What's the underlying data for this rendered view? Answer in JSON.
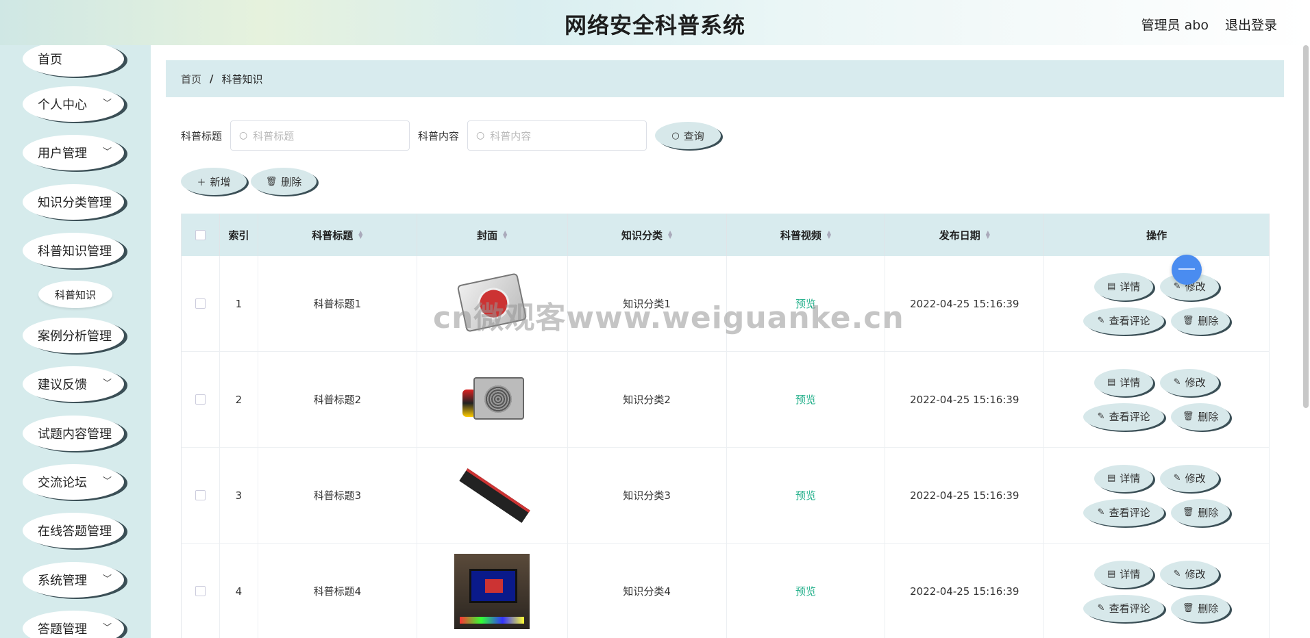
{
  "header": {
    "title": "网络安全科普系统",
    "user": "管理员 abo",
    "logout": "退出登录"
  },
  "sidebar": {
    "items": [
      {
        "label": "首页",
        "has_children": false
      },
      {
        "label": "个人中心",
        "has_children": true
      },
      {
        "label": "用户管理",
        "has_children": true
      },
      {
        "label": "知识分类管理",
        "has_children": false
      },
      {
        "label": "科普知识管理",
        "has_children": false
      },
      {
        "label": "案例分析管理",
        "has_children": false
      },
      {
        "label": "建议反馈",
        "has_children": true
      },
      {
        "label": "试题内容管理",
        "has_children": false
      },
      {
        "label": "交流论坛",
        "has_children": true
      },
      {
        "label": "在线答题管理",
        "has_children": false
      },
      {
        "label": "系统管理",
        "has_children": true
      },
      {
        "label": "答题管理",
        "has_children": true
      }
    ],
    "sub_item": "科普知识"
  },
  "breadcrumb": {
    "home": "首页",
    "separator": "/",
    "current": "科普知识"
  },
  "search": {
    "title_label": "科普标题",
    "title_placeholder": "科普标题",
    "content_label": "科普内容",
    "content_placeholder": "科普内容",
    "query_button": "查询"
  },
  "actions": {
    "add": "新增",
    "delete": "删除"
  },
  "table": {
    "columns": [
      "索引",
      "科普标题",
      "封面",
      "知识分类",
      "科普视频",
      "发布日期",
      "操作"
    ],
    "rows": [
      {
        "index": "1",
        "title": "科普标题1",
        "category": "知识分类1",
        "video": "预览",
        "date": "2022-04-25 15:16:39"
      },
      {
        "index": "2",
        "title": "科普标题2",
        "category": "知识分类2",
        "video": "预览",
        "date": "2022-04-25 15:16:39"
      },
      {
        "index": "3",
        "title": "科普标题3",
        "category": "知识分类3",
        "video": "预览",
        "date": "2022-04-25 15:16:39"
      },
      {
        "index": "4",
        "title": "科普标题4",
        "category": "知识分类4",
        "video": "预览",
        "date": "2022-04-25 15:16:39"
      }
    ],
    "ops": {
      "detail": "详情",
      "edit": "修改",
      "comments": "查看评论",
      "delete": "删除"
    }
  },
  "watermark": "cn微观客www.weiguanke.cn",
  "icons": {
    "search": "search-icon",
    "add": "plus-icon",
    "delete": "trash-icon",
    "detail": "document-icon",
    "edit": "pencil-icon",
    "chevron": "chevron-down-icon"
  },
  "colors": {
    "sidebar_bg": "#d6ebec",
    "header_band": "#d8ebee",
    "preview_link": "#2bb38f",
    "pill_bg": "#d7e8ea"
  }
}
